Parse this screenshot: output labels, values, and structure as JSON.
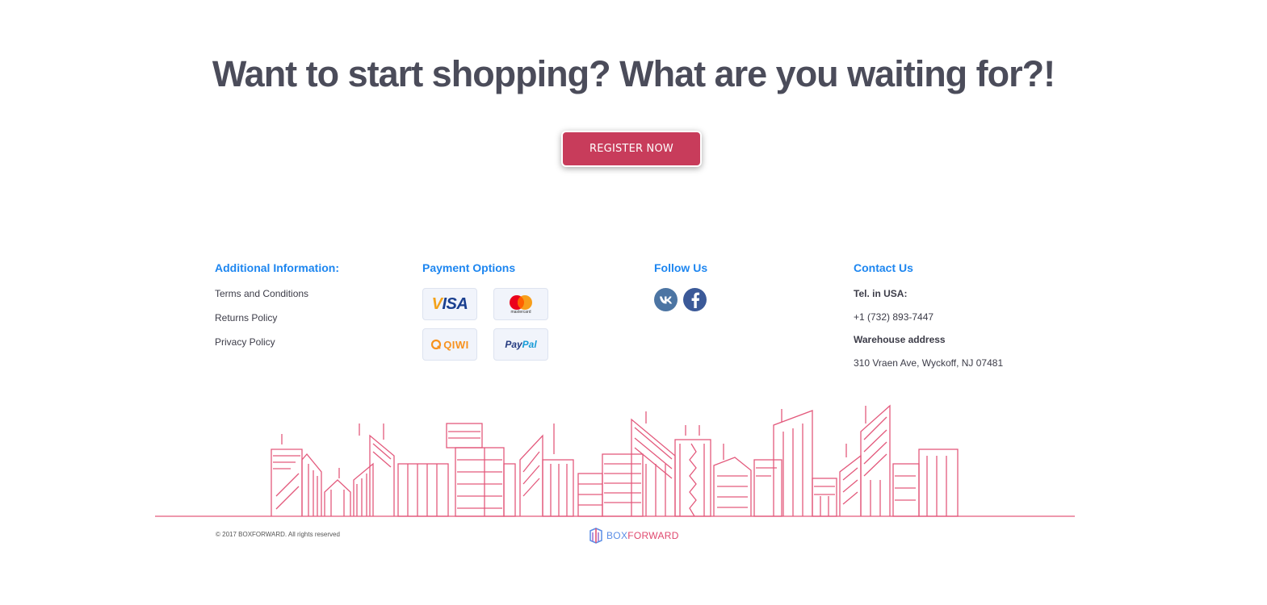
{
  "hero": {
    "title": "Want to start shopping? What are you waiting for?!",
    "cta_label": "REGISTER NOW"
  },
  "footer": {
    "additional": {
      "title": "Additional Information:",
      "links": [
        "Terms and Conditions",
        "Returns Policy",
        "Privacy Policy"
      ]
    },
    "payment": {
      "title": "Payment Options",
      "methods": [
        {
          "name": "VISA",
          "icon": "visa-icon"
        },
        {
          "name": "mastercard",
          "icon": "mastercard-icon"
        },
        {
          "name": "QIWI",
          "icon": "qiwi-icon"
        },
        {
          "name": "PayPal",
          "icon": "paypal-icon"
        }
      ]
    },
    "follow": {
      "title": "Follow Us",
      "networks": [
        {
          "name": "VK",
          "icon": "vk-icon",
          "color": "#4c75a3"
        },
        {
          "name": "Facebook",
          "icon": "facebook-icon",
          "color": "#3b5998"
        }
      ]
    },
    "contact": {
      "title": "Contact Us",
      "tel_label": "Tel. in USA:",
      "tel_value": "+1 (732) 893-7447",
      "address_label": "Warehouse address",
      "address_value": "310 Vraen Ave, Wyckoff, NJ 07481"
    },
    "copyright": "© 2017 BOXFORWARD. All rights reserved",
    "logo": {
      "part1": "BOX",
      "part2": "FORWARD"
    }
  },
  "colors": {
    "accent": "#c83c5b",
    "link_blue": "#1d86f0",
    "skyline": "#e0486e",
    "text": "#4b4c5a"
  }
}
